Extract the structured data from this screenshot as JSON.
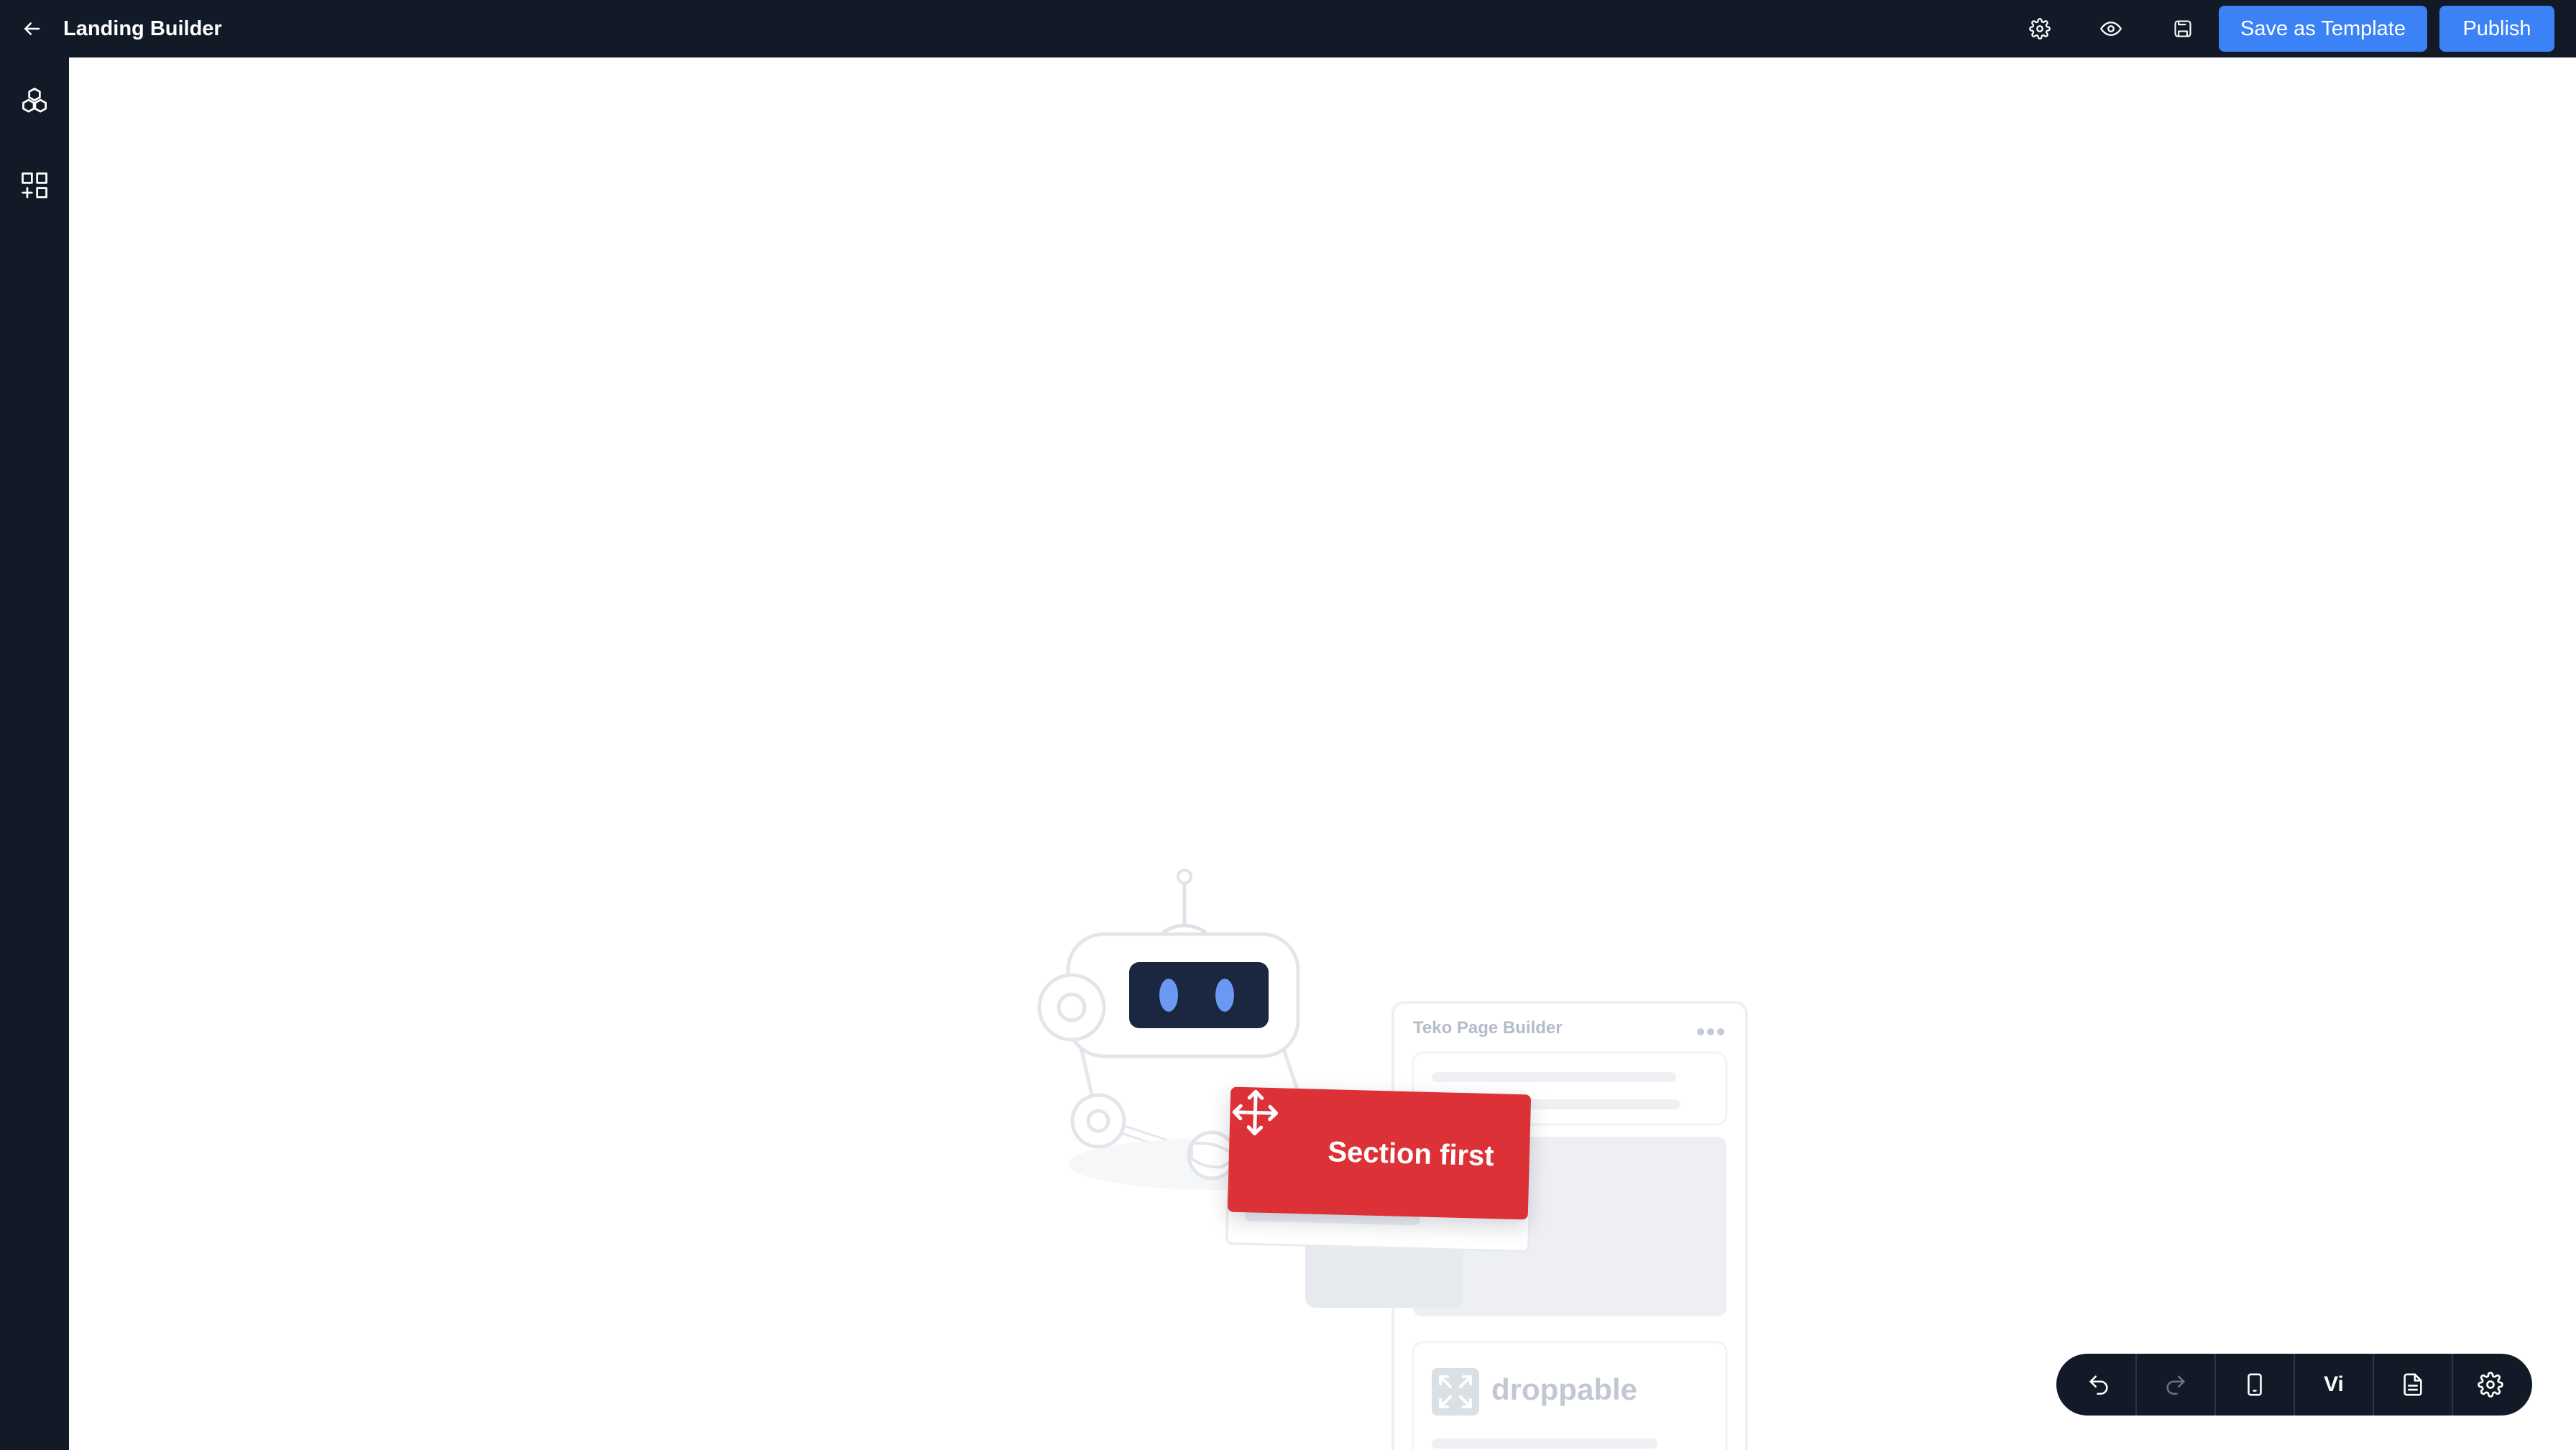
{
  "app": {
    "title": "Landing Builder"
  },
  "header": {
    "back_icon": "arrow-left-icon",
    "icons": [
      "gear-icon",
      "eye-icon",
      "save-disk-icon"
    ],
    "save_template_label": "Save as Template",
    "publish_label": "Publish"
  },
  "sidebar": {
    "items": [
      {
        "icon": "components-cubes-icon"
      },
      {
        "icon": "add-section-grid-icon"
      }
    ]
  },
  "canvas": {
    "empty_state": {
      "card_title": "Teko Page Builder",
      "tag_label": "Section first",
      "droppable_label": "droppable"
    }
  },
  "toolbar": {
    "items": [
      {
        "icon": "undo-icon"
      },
      {
        "icon": "redo-icon"
      },
      {
        "icon": "mobile-device-icon"
      },
      {
        "label": "Vi"
      },
      {
        "icon": "document-icon"
      },
      {
        "icon": "settings-icon"
      }
    ]
  },
  "colors": {
    "topbar_bg": "#131a27",
    "accent": "#3b82f6",
    "tag_red": "#dc3237",
    "canvas_bg": "#ffffff"
  }
}
